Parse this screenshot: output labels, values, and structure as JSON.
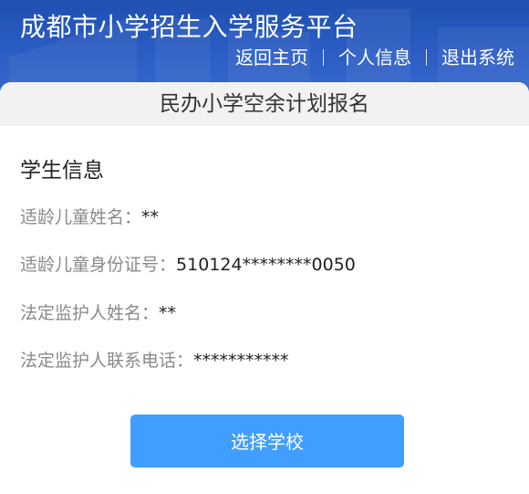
{
  "header": {
    "site_title": "成都市小学招生入学服务平台",
    "nav": {
      "home": "返回主页",
      "profile": "个人信息",
      "logout": "退出系统"
    }
  },
  "card": {
    "title": "民办小学空余计划报名",
    "section_title": "学生信息",
    "fields": [
      {
        "label": "适龄儿童姓名：",
        "value": "**"
      },
      {
        "label": "适龄儿童身份证号：",
        "value": "510124********0050"
      },
      {
        "label": "法定监护人姓名：",
        "value": "**"
      },
      {
        "label": "法定监护人联系电话：",
        "value": "***********"
      }
    ],
    "action_button": "选择学校"
  },
  "colors": {
    "header_bg": "#2a5cc4",
    "button_bg": "#409eff",
    "label_text": "#8a8a8a"
  }
}
